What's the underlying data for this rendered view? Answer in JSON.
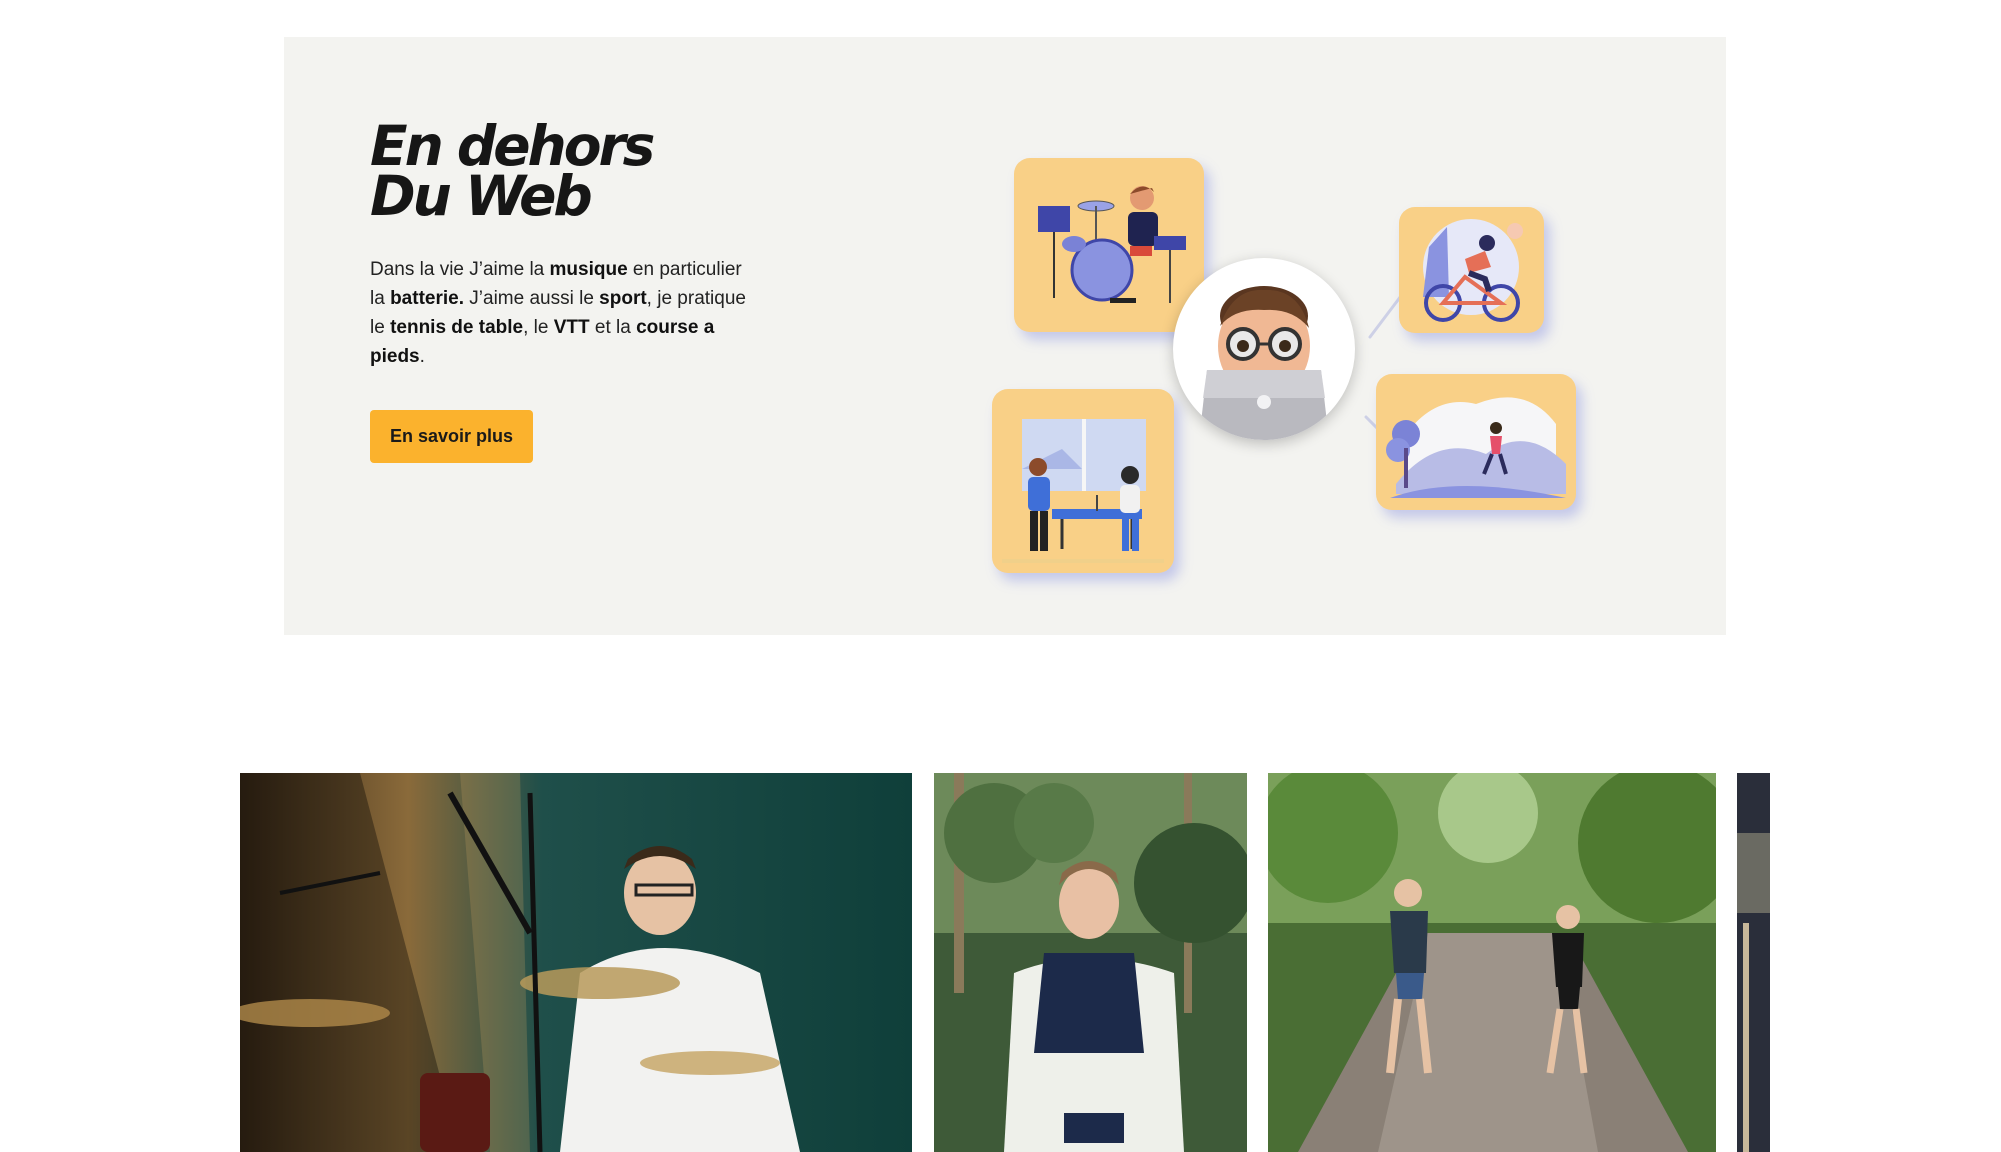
{
  "section": {
    "title_line1": "En dehors",
    "title_line2": "Du Web",
    "text": {
      "p1": "Dans la vie J’aime la ",
      "b1": "musique",
      "p2": " en particulier la ",
      "b2": "batterie.",
      "p3": " J’aime aussi le ",
      "b3": "sport",
      "p4": ", je pratique le ",
      "b4": "tennis de table",
      "p5": ", le ",
      "b5": "VTT",
      "p6": " et la ",
      "b6": "course a pieds",
      "p7": "."
    },
    "cta_label": "En savoir plus"
  },
  "illustration": {
    "center": "memoji-laptop",
    "cards": [
      "drums-illustration",
      "cycling-illustration",
      "table-tennis-illustration",
      "running-illustration"
    ],
    "card_color": "#f9d087",
    "accent_color": "#6b72d8"
  },
  "gallery": {
    "photos": [
      "drummer-photo",
      "trail-runner-photo",
      "two-runners-photo",
      "partial-photo"
    ]
  },
  "colors": {
    "cta": "#fbb22d",
    "section_bg": "#f3f3f0"
  }
}
